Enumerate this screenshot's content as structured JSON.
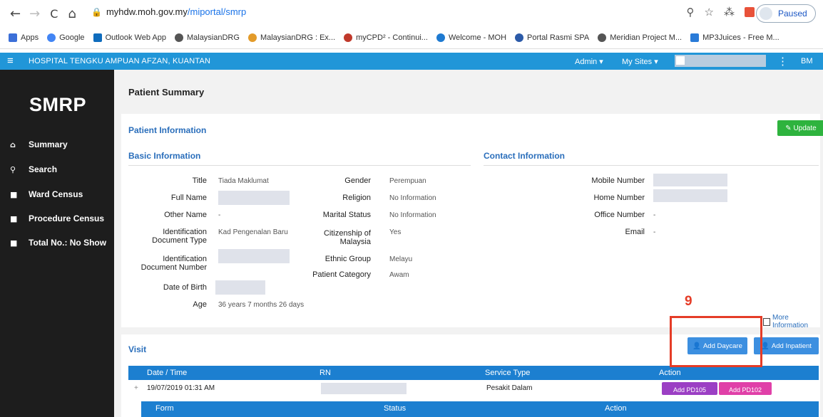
{
  "browser": {
    "back": "←",
    "forward": "→",
    "reload": "C",
    "home": "⌂",
    "url_host": "myhdw.moh.gov.my",
    "url_path": "/miportal/smrp",
    "profile_status": "Paused",
    "bookmarks": [
      "Apps",
      "Google",
      "Outlook Web App",
      "MalaysianDRG",
      "MalaysianDRG : Ex...",
      "myCPD² - Continui...",
      "Welcome - MOH",
      "Portal Rasmi SPA",
      "Meridian Project M...",
      "MP3Juices - Free M..."
    ]
  },
  "topbar": {
    "hospital": "HOSPITAL TENGKU AMPUAN AFZAN, KUANTAN",
    "admin": "Admin ▾",
    "my_sites": "My Sites ▾",
    "user_initials": "BM"
  },
  "sidebar": {
    "logo": "SMRP",
    "items": [
      {
        "icon": "home-icon",
        "label": "Summary"
      },
      {
        "icon": "search-icon",
        "label": "Search"
      },
      {
        "icon": "briefcase-icon",
        "label": "Ward Census"
      },
      {
        "icon": "briefcase-icon",
        "label": "Procedure Census"
      },
      {
        "icon": "briefcase-icon",
        "label": "Total No.: No Show"
      }
    ]
  },
  "page": {
    "title": "Patient Summary",
    "patient_info_title": "Patient Information",
    "update_label": "✎ Update",
    "basic_title": "Basic Information",
    "contact_title": "Contact Information",
    "basic_left": {
      "title_label": "Title",
      "title_value": "Tiada Maklumat",
      "full_name_label": "Full Name",
      "other_name_label": "Other Name",
      "other_name_value": "-",
      "id_type_label": "Identification Document Type",
      "id_type_value": "Kad Pengenalan Baru",
      "id_number_label": "Identification Document Number",
      "dob_label": "Date of Birth",
      "age_label": "Age",
      "age_value": "36 years 7 months 26 days"
    },
    "basic_right": {
      "gender_label": "Gender",
      "gender_value": "Perempuan",
      "religion_label": "Religion",
      "religion_value": "No Information",
      "marital_label": "Marital Status",
      "marital_value": "No Information",
      "citizen_label": "Citizenship of Malaysia",
      "citizen_value": "Yes",
      "ethnic_label": "Ethnic Group",
      "ethnic_value": "Melayu",
      "category_label": "Patient Category",
      "category_value": "Awam"
    },
    "contact": {
      "mobile_label": "Mobile Number",
      "home_label": "Home Number",
      "office_label": "Office Number",
      "office_value": "-",
      "email_label": "Email",
      "email_value": "-"
    },
    "more_info": "More Information",
    "annotation_number": "9"
  },
  "visit": {
    "title": "Visit",
    "add_daycare": "Add Daycare",
    "add_inpatient": "Add Inpatient",
    "columns": [
      "Date / Time",
      "RN",
      "Service Type",
      "Action"
    ],
    "rows": [
      {
        "expand": "+",
        "datetime": "19/07/2019 01:31 AM",
        "service": "Pesakit Dalam",
        "actions": [
          "Add PD105",
          "Add PD102"
        ]
      }
    ],
    "sub_columns": [
      "Form",
      "Status",
      "Action"
    ]
  },
  "colors": {
    "topbar": "#2196d8",
    "sidebar": "#1d1d1d",
    "link": "#2a6ebb",
    "update": "#2eb33e",
    "annotation": "#e53c27",
    "pd105": "#9b3fc4",
    "pd102": "#e040a8"
  }
}
